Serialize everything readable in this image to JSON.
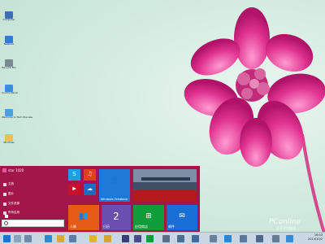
{
  "desktop_icons": [
    {
      "label": "Computer",
      "icon": "computer-icon",
      "color": "#3a6fb0"
    },
    {
      "label": "Network",
      "icon": "network-icon",
      "color": "#2e7fd0"
    },
    {
      "label": "Recycle Bin",
      "icon": "recycle-bin-icon",
      "color": "#7a8898"
    },
    {
      "label": "Control Panel",
      "icon": "control-panel-icon",
      "color": "#3c8edc"
    },
    {
      "label": "Welcome to Tech Preview",
      "icon": "welcome-icon",
      "color": "#4aa0e0"
    },
    {
      "label": "Windows",
      "icon": "folder-icon",
      "color": "#e8c34a"
    }
  ],
  "start_menu": {
    "user_name": "star 1020",
    "items": [
      {
        "label": "文档",
        "icon": "document-icon"
      },
      {
        "label": "图片",
        "icon": "pictures-icon"
      },
      {
        "label": "文件资源",
        "icon": "explorer-icon"
      },
      {
        "label": "所有应用",
        "icon": "all-apps-icon"
      }
    ],
    "search_placeholder": ""
  },
  "tiles": {
    "skype": {
      "icon": "skype-icon",
      "color": "#1ea0e0"
    },
    "music": {
      "icon": "headphones-icon",
      "color": "#e1401c"
    },
    "video": {
      "icon": "video-icon",
      "color": "#c8102e"
    },
    "onedrive": {
      "icon": "cloud-icon",
      "color": "#1b6cc4"
    },
    "feedback": {
      "label": "Windows Feedback",
      "icon": "feedback-icon",
      "color": "#1f7ad6"
    },
    "news": {
      "icon": "news-icon",
      "color": "#b31b1b"
    },
    "people": {
      "label": "人脉",
      "icon": "people-icon",
      "color": "#e65b17"
    },
    "calendar": {
      "label": "日历",
      "number": "2",
      "color": "#6a4fb0"
    },
    "store": {
      "label": "应用商店",
      "icon": "store-icon",
      "color": "#0f9d3a"
    },
    "mail": {
      "label": "邮件",
      "icon": "mail-icon",
      "color": "#1a6fd6"
    }
  },
  "taskbar": {
    "clock_time": "16:03",
    "clock_date": "2014/10/2"
  },
  "watermark": {
    "brand": "PConline",
    "sub": "太平洋电脑网"
  }
}
